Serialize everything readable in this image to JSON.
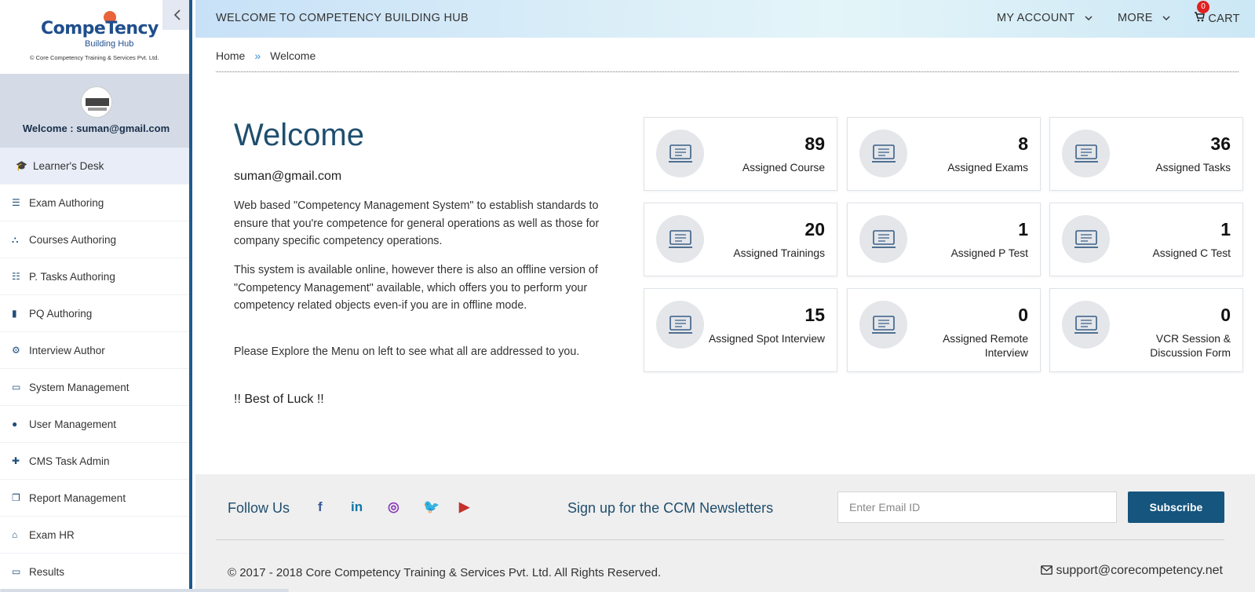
{
  "sidebar": {
    "logo": {
      "main": "CompeTency",
      "sub": "Building Hub",
      "copyright": "© Core Competency Training & Services Pvt. Ltd."
    },
    "collapse_icon": "chevron-left-icon",
    "welcome": "Welcome : suman@gmail.com",
    "items": [
      {
        "label": "Learner's Desk",
        "icon": "graduation-cap-icon"
      },
      {
        "label": "Exam Authoring",
        "icon": "list-icon"
      },
      {
        "label": "Courses Authoring",
        "icon": "sitemap-icon"
      },
      {
        "label": "P. Tasks Authoring",
        "icon": "tasks-icon"
      },
      {
        "label": "PQ Authoring",
        "icon": "book-icon"
      },
      {
        "label": "Interview Author",
        "icon": "cogs-icon"
      },
      {
        "label": "System Management",
        "icon": "desktop-icon"
      },
      {
        "label": "User Management",
        "icon": "user-icon"
      },
      {
        "label": "CMS Task Admin",
        "icon": "user-plus-icon"
      },
      {
        "label": "Report Management",
        "icon": "copy-icon"
      },
      {
        "label": "Exam HR",
        "icon": "bank-icon"
      },
      {
        "label": "Results",
        "icon": "desktop-icon"
      }
    ]
  },
  "topbar": {
    "title": "WELCOME TO COMPETENCY BUILDING HUB",
    "my_account": "MY ACCOUNT",
    "more": "MORE",
    "cart": "CART",
    "cart_count": "0"
  },
  "breadcrumb": {
    "home": "Home",
    "sep": "»",
    "current": "Welcome"
  },
  "main": {
    "title": "Welcome",
    "email": "suman@gmail.com",
    "paragraphs": [
      "Web based \"Competency Management System\" to establish standards to ensure that you're competence for general operations as well as those for company specific competency operations.",
      "This system is available online, however there is also an offline version of \"Competency Management\" available, which offers you to perform your competency related objects even-if you are in offline mode.",
      "Please Explore the Menu on left to see what all are addressed to you."
    ],
    "luck": "!! Best of Luck !!"
  },
  "cards": [
    {
      "value": "89",
      "label": "Assigned Course",
      "icon": "book-monitor-icon"
    },
    {
      "value": "8",
      "label": "Assigned Exams",
      "icon": "exam-clipboard-icon"
    },
    {
      "value": "36",
      "label": "Assigned Tasks",
      "icon": "task-laptop-icon"
    },
    {
      "value": "20",
      "label": "Assigned Trainings",
      "icon": "training-laptop-icon"
    },
    {
      "value": "1",
      "label": "Assigned P Test",
      "icon": "p-test-clipboard-icon"
    },
    {
      "value": "1",
      "label": "Assigned C Test",
      "icon": "c-test-clipboard-icon"
    },
    {
      "value": "15",
      "label": "Assigned Spot Interview",
      "icon": "spot-interview-icon"
    },
    {
      "value": "0",
      "label": "Assigned Remote Interview",
      "icon": "remote-interview-icon"
    },
    {
      "value": "0",
      "label": "VCR Session & Discussion Form",
      "icon": "vcr-monitor-icon"
    }
  ],
  "footer": {
    "follow": "Follow Us",
    "social": [
      {
        "name": "facebook-icon",
        "glyph": "f",
        "color": "#3b5998"
      },
      {
        "name": "linkedin-icon",
        "glyph": "in",
        "color": "#0e76a8"
      },
      {
        "name": "instagram-icon",
        "glyph": "◎",
        "color": "#8a3ab9"
      },
      {
        "name": "twitter-icon",
        "glyph": "🐦",
        "color": "#1da1f2"
      },
      {
        "name": "youtube-icon",
        "glyph": "▶",
        "color": "#c4302b"
      }
    ],
    "newsletter": "Sign up for the CCM Newsletters",
    "email_placeholder": "Enter Email ID",
    "subscribe": "Subscribe",
    "copyright": "© 2017 - 2018 Core Competency Training & Services Pvt. Ltd. All Rights Reserved.",
    "support": "support@corecompetency.net"
  },
  "colors": {
    "accent": "#1f4e6e",
    "button": "#15557e",
    "sidebar_border": "#1f5a8c",
    "badge": "#e02020"
  }
}
